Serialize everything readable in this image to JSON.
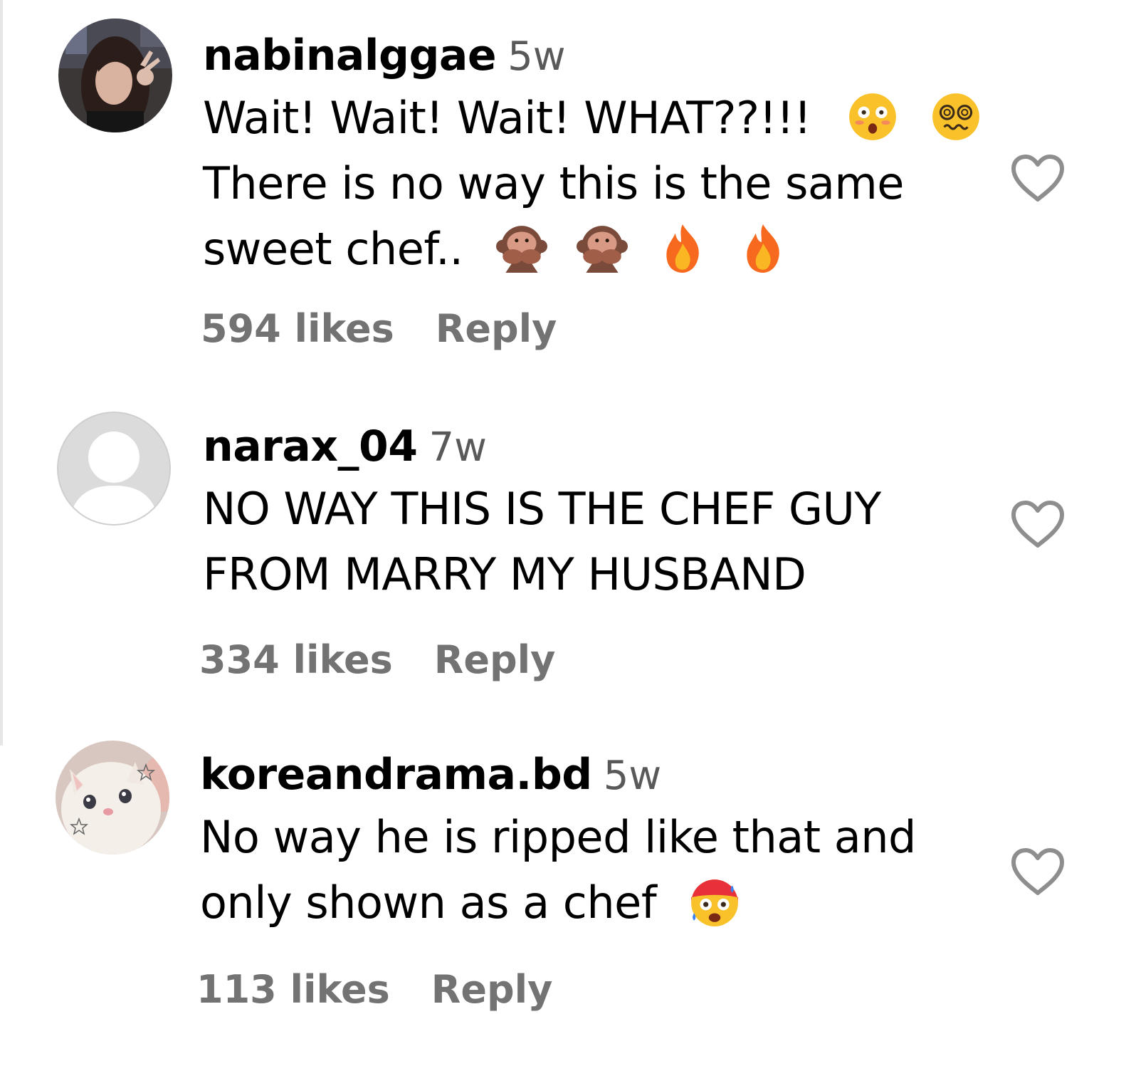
{
  "comments": [
    {
      "username": "nabinalggae",
      "time": "5w",
      "line1": "Wait! Wait! Wait! WHAT??!!!",
      "line2": "There is no way this is the same",
      "line3": "sweet chef..",
      "likes": "594 likes",
      "reply": "Reply",
      "emojis": [
        "flushed-face",
        "woozy-face",
        "speak-no-evil-monkey",
        "speak-no-evil-monkey",
        "fire",
        "fire"
      ]
    },
    {
      "username": "narax_04",
      "time": "7w",
      "line1": "NO WAY THIS IS THE CHEF GUY",
      "line2": "FROM MARRY MY HUSBAND",
      "likes": "334 likes",
      "reply": "Reply"
    },
    {
      "username": "koreandrama.bd",
      "time": "5w",
      "line1": "No way he is ripped like that and",
      "line2": "only shown as a chef",
      "likes": "113 likes",
      "reply": "Reply",
      "emojis": [
        "hot-face"
      ]
    }
  ],
  "colors": {
    "text": "#000000",
    "secondary": "#737373",
    "heart_outline": "#8e8e8e",
    "default_avatar_bg": "#dbdbdb"
  }
}
